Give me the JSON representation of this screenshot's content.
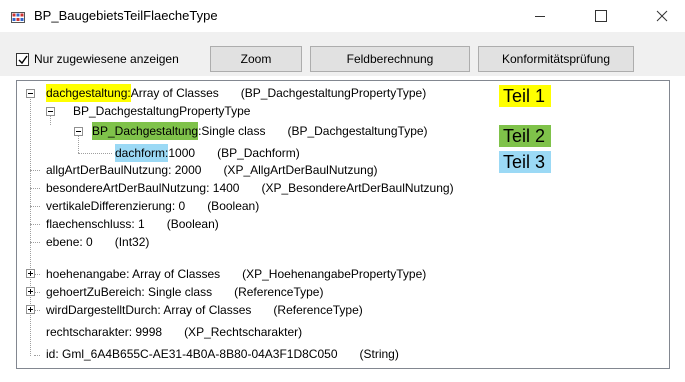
{
  "window": {
    "title": "BP_BaugebietsTeilFlaecheType",
    "icon": "app-grid-icon",
    "controls": [
      "minimize-icon",
      "maximize-icon",
      "close-icon"
    ]
  },
  "toolbar": {
    "checkbox_label": "Nur zugewiesene anzeigen",
    "checkbox_checked": true,
    "zoom_label": "Zoom",
    "calc_label": "Feldberechnung",
    "conformity_label": "Konformitätsprüfung"
  },
  "tree": {
    "n0": {
      "name": "dachgestaltung",
      "sep": ": ",
      "value": "Array of Classes",
      "type": "(BP_DachgestaltungPropertyType)"
    },
    "n1": {
      "name": "BP_DachgestaltungPropertyType"
    },
    "n2": {
      "name": "BP_Dachgestaltung",
      "sep": ": ",
      "value": "Single class",
      "type": "(BP_DachgestaltungType)"
    },
    "n3": {
      "name": "dachform",
      "sep": ": ",
      "value": "1000",
      "type": "(BP_Dachform)"
    },
    "n4": {
      "text": "allgArtDerBaulNutzung: 2000",
      "type": "(XP_AllgArtDerBaulNutzung)"
    },
    "n5": {
      "text": "besondereArtDerBaulNutzung: 1400",
      "type": "(XP_BesondereArtDerBaulNutzung)"
    },
    "n6": {
      "text": "vertikaleDifferenzierung: 0",
      "type": "(Boolean)"
    },
    "n7": {
      "text": "flaechenschluss: 1",
      "type": "(Boolean)"
    },
    "n8": {
      "text": "ebene: 0",
      "type": "(Int32)"
    },
    "n9": {
      "text": "hoehenangabe: Array of Classes",
      "type": "(XP_HoehenangabePropertyType)"
    },
    "n10": {
      "text": "gehoertZuBereich: Single class",
      "type": "(ReferenceType)"
    },
    "n11": {
      "text": "wirdDargestelltDurch: Array of Classes",
      "type": "(ReferenceType)"
    },
    "n12": {
      "text": "rechtscharakter: 9998",
      "type": "(XP_Rechtscharakter)"
    },
    "n13": {
      "text": "id: Gml_6A4B655C-AE31-4B0A-8B80-04A3F1D8C050",
      "type": "(String)"
    }
  },
  "annotations": {
    "teil1": {
      "label": "Teil 1",
      "color": "#ffff00"
    },
    "teil2": {
      "label": "Teil 2",
      "color": "#7fc24a"
    },
    "teil3": {
      "label": "Teil 3",
      "color": "#9bd9f5"
    }
  }
}
